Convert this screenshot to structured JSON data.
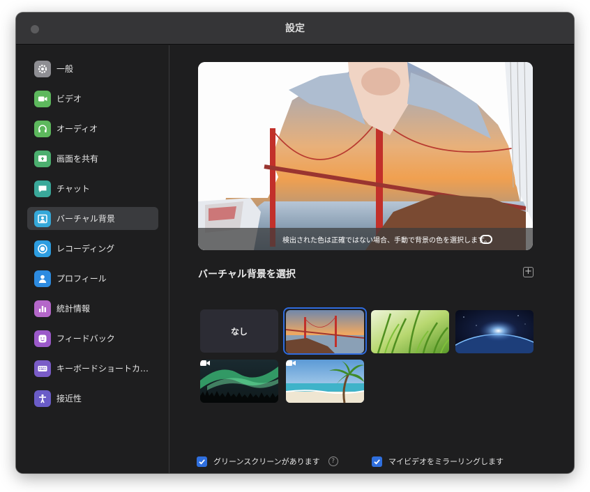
{
  "window": {
    "title": "設定"
  },
  "sidebar": {
    "items": [
      {
        "label": "一般",
        "icon": "gear-icon",
        "color": "#8e8e93"
      },
      {
        "label": "ビデオ",
        "icon": "video-camera-icon",
        "color": "#5db85d"
      },
      {
        "label": "オーディオ",
        "icon": "headphones-icon",
        "color": "#5db85d"
      },
      {
        "label": "画面を共有",
        "icon": "share-screen-icon",
        "color": "#4caf6f"
      },
      {
        "label": "チャット",
        "icon": "chat-bubble-icon",
        "color": "#3aa89a"
      },
      {
        "label": "バーチャル背景",
        "icon": "virtual-background-icon",
        "color": "#35a8d8",
        "active": true
      },
      {
        "label": "レコーディング",
        "icon": "record-icon",
        "color": "#2d9de0"
      },
      {
        "label": "プロフィール",
        "icon": "user-icon",
        "color": "#2d8be0"
      },
      {
        "label": "統計情報",
        "icon": "bar-chart-icon",
        "color": "#b467c9"
      },
      {
        "label": "フィードバック",
        "icon": "smiley-icon",
        "color": "#9b59c9"
      },
      {
        "label": "キーボードショートカ…",
        "icon": "keyboard-icon",
        "color": "#7a5cc7"
      },
      {
        "label": "接近性",
        "icon": "accessibility-icon",
        "color": "#6a5cc7"
      }
    ]
  },
  "preview": {
    "caption": "検出された色は正確ではない場合、手動で背景の色を選択します。"
  },
  "backgrounds": {
    "title": "バーチャル背景を選択",
    "none_label": "なし",
    "items": [
      {
        "name": "none",
        "selected": false
      },
      {
        "name": "golden-gate-bridge",
        "selected": true
      },
      {
        "name": "grass",
        "selected": false
      },
      {
        "name": "earth-from-space",
        "selected": false
      },
      {
        "name": "aurora-video",
        "selected": false
      },
      {
        "name": "beach-video",
        "selected": false
      }
    ]
  },
  "options": {
    "green_screen_label": "グリーンスクリーンがあります",
    "green_screen_checked": true,
    "mirror_label": "マイビデオをミラーリングします",
    "mirror_checked": true
  }
}
